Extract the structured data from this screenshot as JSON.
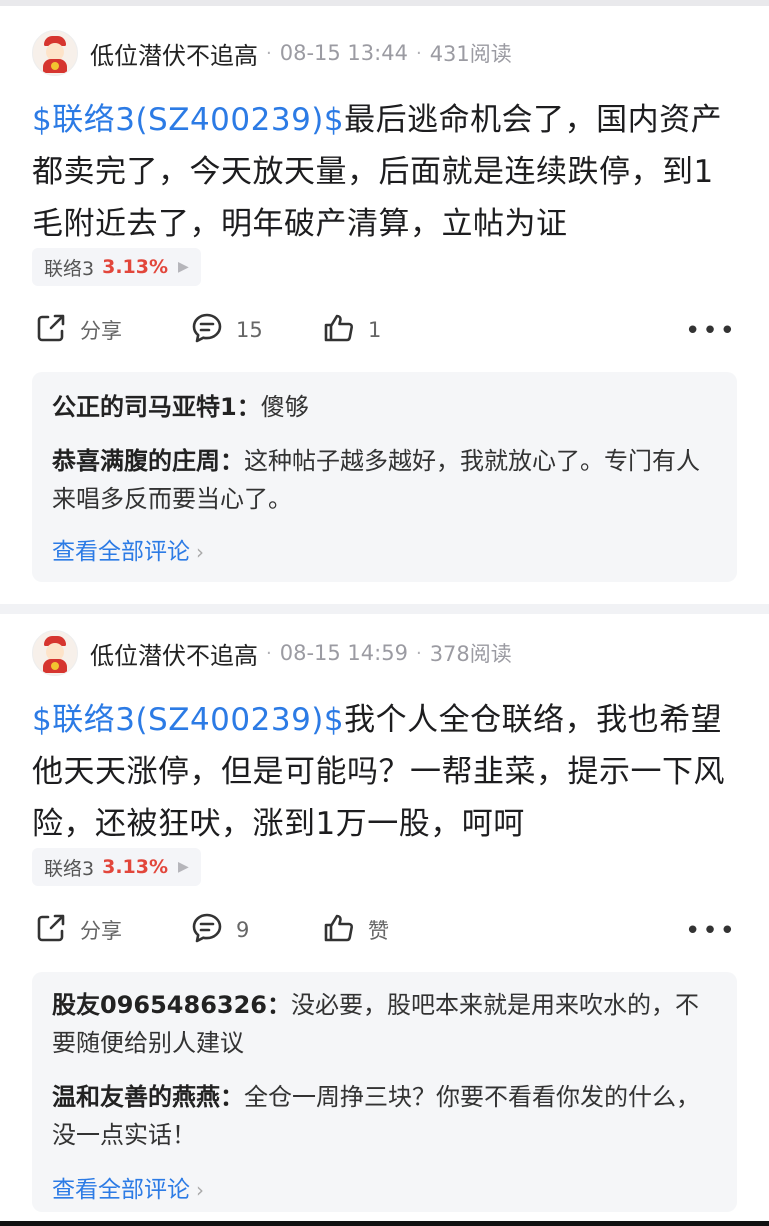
{
  "posts": [
    {
      "author": "低位潜伏不追高",
      "time": "08-15 13:44",
      "reads": "431阅读",
      "stock_link": "$联络3(SZ400239)$",
      "text": "最后逃命机会了，国内资产都卖完了，今天放天量，后面就是连续跌停，到1毛附近去了，明年破产清算，立帖为证",
      "tag": {
        "name": "联络3",
        "pct": "3.13%"
      },
      "share_label": "分享",
      "comment_count": "15",
      "like_label": "1",
      "comments": [
        {
          "user": "公正的司马亚特1：",
          "text": "傻够"
        },
        {
          "user": "恭喜满腹的庄周：",
          "text": "这种帖子越多越好，我就放心了。专门有人来唱多反而要当心了。"
        }
      ],
      "view_all": "查看全部评论"
    },
    {
      "author": "低位潜伏不追高",
      "time": "08-15 14:59",
      "reads": "378阅读",
      "stock_link": "$联络3(SZ400239)$",
      "text": "我个人全仓联络，我也希望他天天涨停，但是可能吗？一帮韭菜，提示一下风险，还被狂吠，涨到1万一股，呵呵",
      "tag": {
        "name": "联络3",
        "pct": "3.13%"
      },
      "share_label": "分享",
      "comment_count": "9",
      "like_label": "赞",
      "comments": [
        {
          "user": "股友0965486326：",
          "text": "没必要，股吧本来就是用来吹水的，不要随便给别人建议"
        },
        {
          "user": "温和友善的燕燕：",
          "text": "全仓一周挣三块？你要不看看你发的什么，没一点实话！"
        }
      ],
      "view_all": "查看全部评论"
    }
  ],
  "colors": {
    "link": "#2c7be5",
    "up": "#e2463b",
    "muted": "#9b9ba2"
  },
  "icons": {
    "share": "share-icon",
    "comment": "comment-icon",
    "like": "thumbs-up-icon",
    "more": "more-icon"
  }
}
